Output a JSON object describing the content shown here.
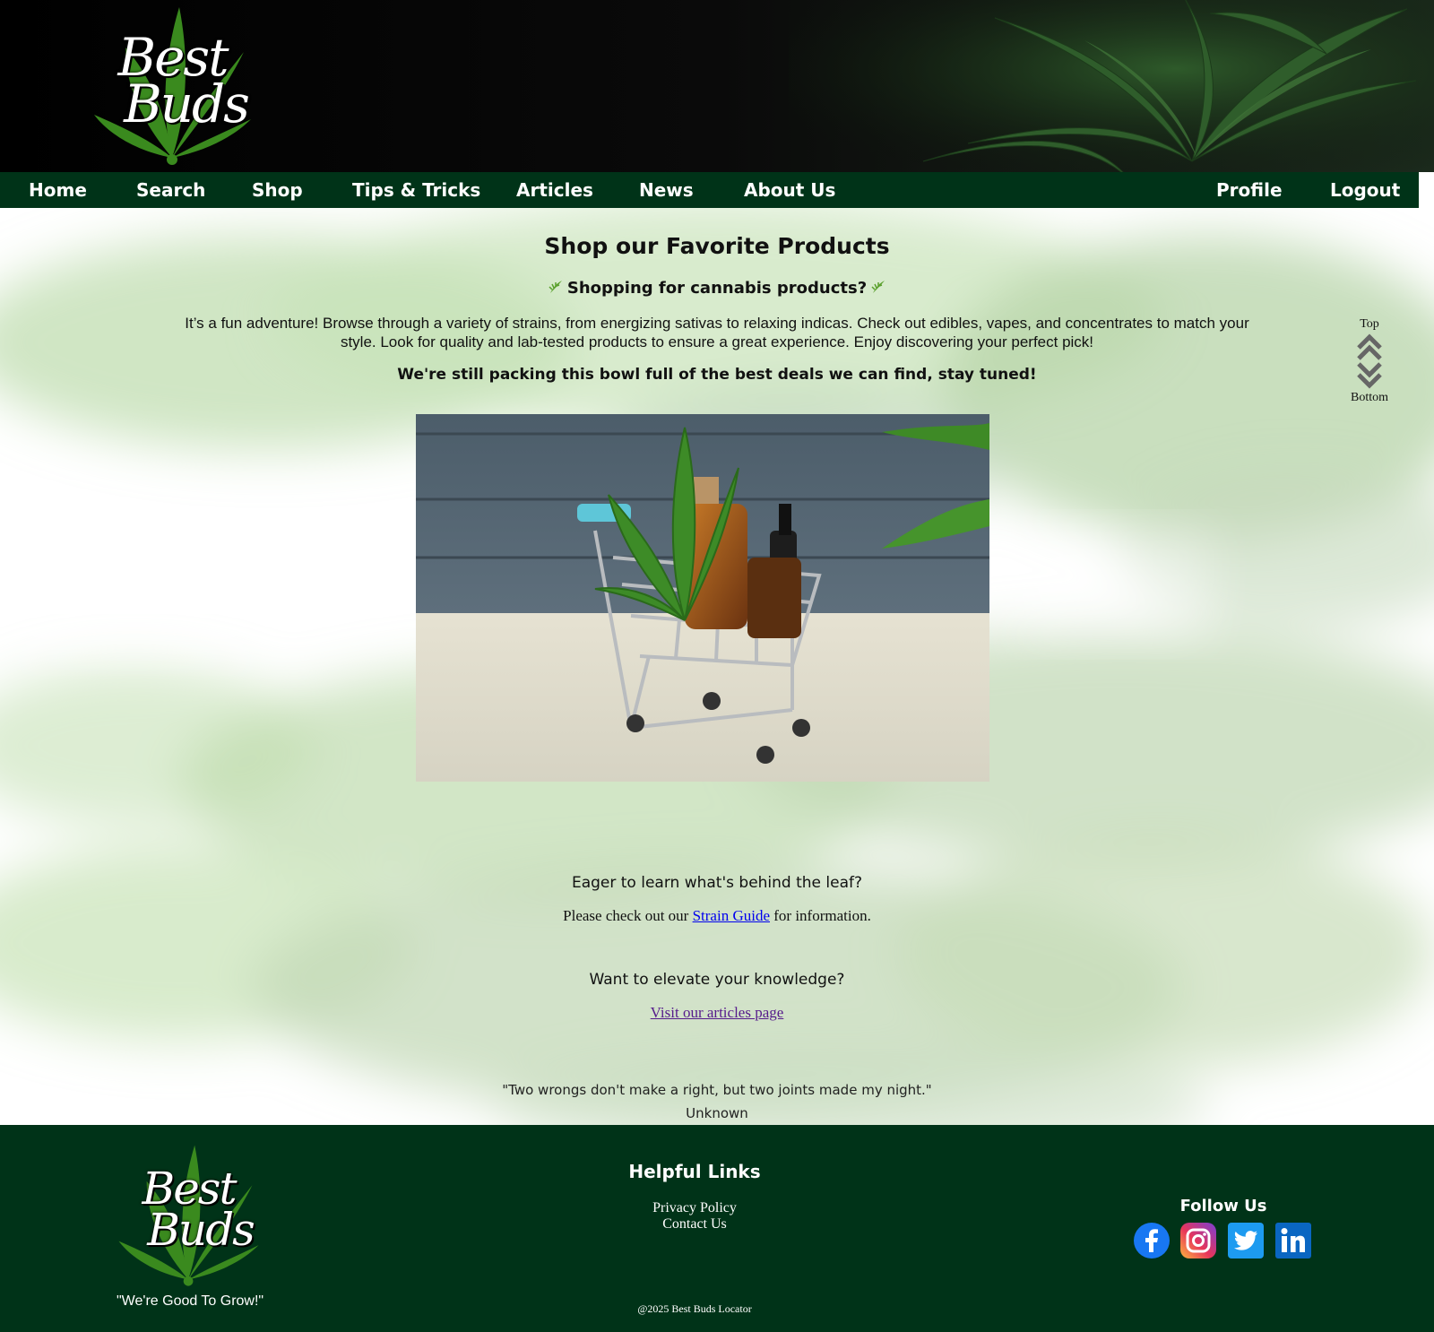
{
  "logo": {
    "alt": "Best Buds",
    "line1": "Best",
    "line2": "Buds"
  },
  "nav": {
    "left": [
      {
        "label": "Home"
      },
      {
        "label": "Search"
      },
      {
        "label": "Shop"
      },
      {
        "label": "Tips & Tricks"
      },
      {
        "label": "Articles"
      },
      {
        "label": "News"
      },
      {
        "label": "About Us"
      }
    ],
    "right": [
      {
        "label": "Profile"
      },
      {
        "label": "Logout"
      }
    ]
  },
  "main": {
    "title": "Shop our Favorite Products",
    "subtitle": "Shopping for cannabis products?",
    "intro": "It’s a fun adventure! Browse through a variety of strains, from energizing sativas to relaxing indicas. Check out edibles, vapes, and concentrates to match your style. Look for quality and lab-tested products to ensure a great experience. Enjoy discovering your perfect pick!",
    "deals": "We're still packing this bowl full of the best deals we can find, stay tuned!",
    "leaf_heading": "Eager to learn what's behind the leaf?",
    "strain_prefix": "Please check out our ",
    "strain_link": "Strain Guide",
    "strain_suffix": " for information.",
    "knowledge_heading": "Want to elevate your knowledge?",
    "articles_link": "Visit our articles page",
    "quote": "\"Two wrongs don't make a right, but two joints made my night.\"",
    "quote_author": "Unknown"
  },
  "scroll": {
    "top_label": "Top",
    "bottom_label": "Bottom"
  },
  "footer": {
    "tagline": "\"We're Good To Grow!\"",
    "helpful_heading": "Helpful Links",
    "links": [
      "Privacy Policy",
      "Contact Us"
    ],
    "follow_heading": "Follow Us",
    "social": [
      "facebook-icon",
      "instagram-icon",
      "twitter-icon",
      "linkedin-icon"
    ],
    "copyright": "@2025 Best Buds Locator"
  },
  "colors": {
    "nav_bg": "#003318",
    "footer_bg": "#003318",
    "leaf_green": "#3a8a1e",
    "link_blue": "#0000ee",
    "link_visited": "#551a8b"
  }
}
